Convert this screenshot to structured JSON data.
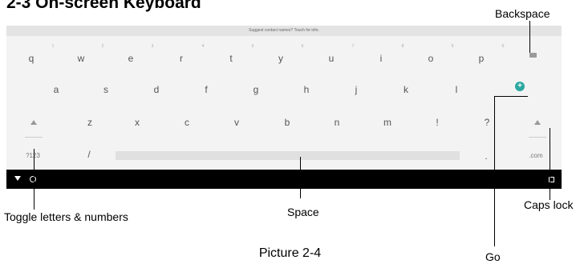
{
  "heading": "2-3 On-screen Keyboard",
  "suggestion_text": "Suggest contact names? Touch for info.",
  "keyboard": {
    "row1": [
      "q",
      "w",
      "e",
      "r",
      "t",
      "y",
      "u",
      "i",
      "o",
      "p"
    ],
    "row1_hints": [
      "1",
      "2",
      "3",
      "4",
      "5",
      "6",
      "7",
      "8",
      "9",
      "0"
    ],
    "row2": [
      "a",
      "s",
      "d",
      "f",
      "g",
      "h",
      "j",
      "k",
      "l"
    ],
    "row3": [
      "z",
      "x",
      "c",
      "v",
      "b",
      "n",
      "m",
      "!",
      "?"
    ],
    "row4": {
      "symbols": "?123",
      "slash": "/",
      "period": ".",
      "dotcom": ".com"
    }
  },
  "icons": {
    "backspace": "backspace-icon",
    "go": "go-icon",
    "shift": "shift-icon",
    "nav_back": "nav-back-icon",
    "nav_home": "nav-home-icon",
    "nav_recents": "nav-recents-icon"
  },
  "colors": {
    "go_button": "#2aa8a0",
    "navbar": "#000000"
  },
  "callouts": {
    "backspace": "Backspace",
    "toggle": "Toggle letters & numbers",
    "space": "Space",
    "caps_lock": "Caps lock",
    "go": "Go"
  },
  "caption": "Picture 2-4"
}
